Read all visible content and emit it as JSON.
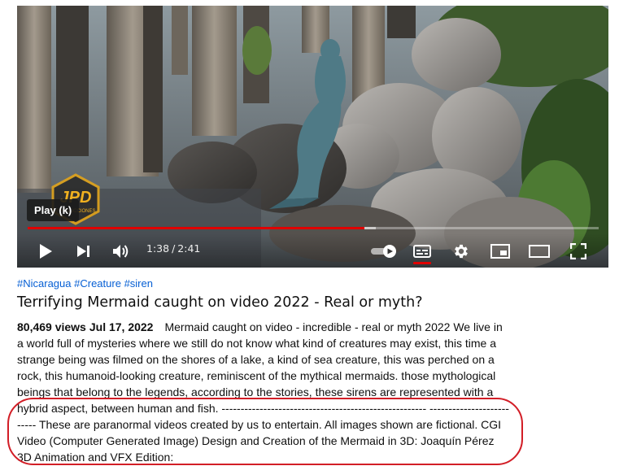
{
  "player": {
    "tooltip": "Play (k)",
    "watermark": "JPD PRODUCCIONES",
    "time_current": "1:38",
    "time_separator": "/",
    "time_total": "2:41",
    "progress_played_fraction": 0.59,
    "progress_buffered_fraction": 0.61,
    "accent_color": "#e00000",
    "controls": {
      "play_icon": "play-icon",
      "next_icon": "next-icon",
      "volume_icon": "volume-icon",
      "autoplay_icon": "autoplay-toggle-icon",
      "subtitles_icon": "subtitles-icon",
      "settings_icon": "gear-icon",
      "miniplayer_icon": "miniplayer-icon",
      "theater_icon": "theater-icon",
      "fullscreen_icon": "fullscreen-icon"
    }
  },
  "hashtags": [
    "#Nicaragua",
    "#Creature",
    "#siren"
  ],
  "video": {
    "title": "Terrifying Mermaid caught on video 2022 - Real or myth?",
    "views": "80,469 views",
    "date": "Jul 17, 2022",
    "description": "Mermaid caught on video - incredible - real or myth 2022 We live in a world full of mysteries where we still do not know what kind of creatures may exist, this time a strange being was filmed on the shores of a lake, a kind of sea creature, this was perched on a rock, this humanoid-looking creature, reminiscent of the mythical mermaids. those mythological beings that belong to the legends, according to the stories, these sirens are represented with a hybrid aspect, between human and fish. ------------------------------------------------------ -------------------------- These are paranormal videos created by us to entertain. All images shown are fictional. CGI Video (Computer Generated Image) Design and Creation of the Mermaid in 3D: Joaquín Pérez 3D Animation and VFX Edition:"
  },
  "annotation_color": "#d21d26"
}
